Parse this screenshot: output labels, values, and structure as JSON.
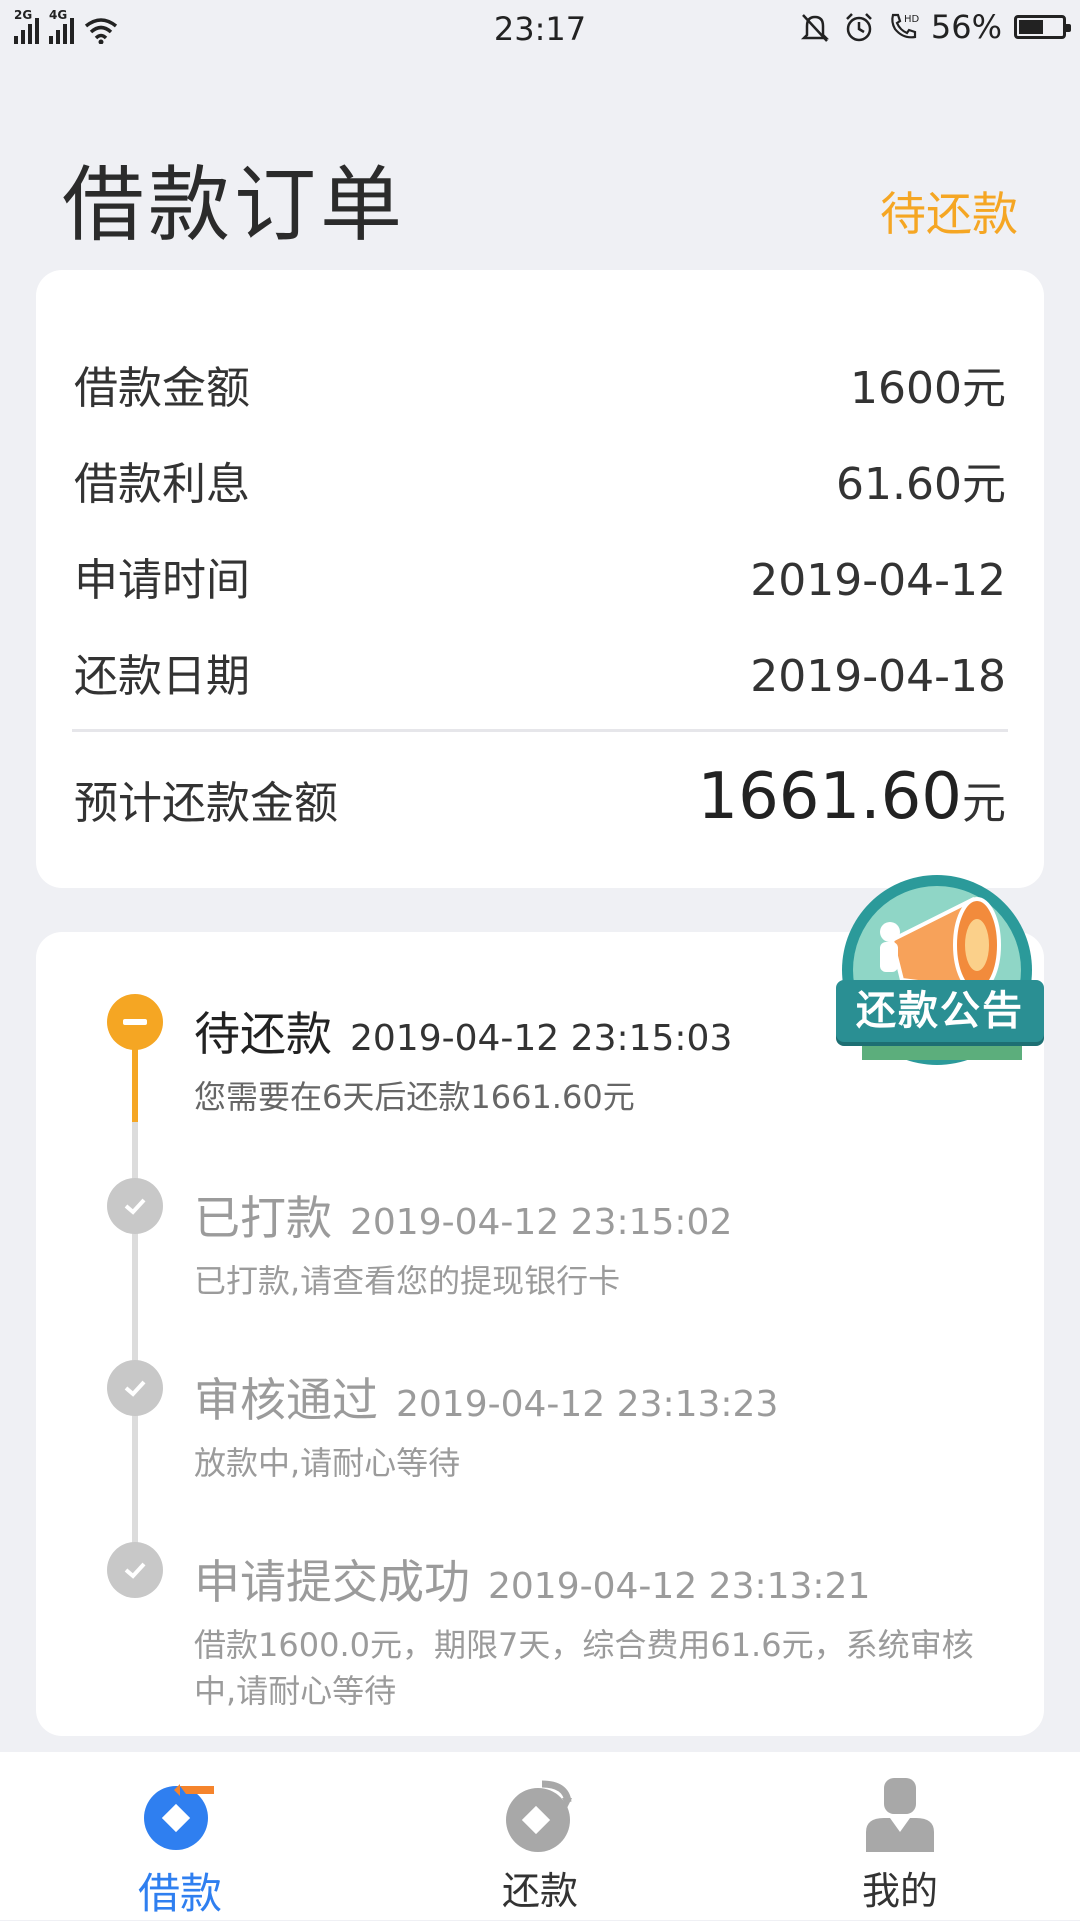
{
  "status_bar": {
    "network_1": "2G",
    "network_2": "4G",
    "time": "23:17",
    "battery": "56%",
    "icons": [
      "signal-icon",
      "wifi-icon",
      "mute-bell-icon",
      "alarm-icon",
      "hd-call-icon",
      "battery-icon"
    ]
  },
  "header": {
    "title": "借款订单",
    "status": "待还款"
  },
  "summary": {
    "rows": [
      {
        "label": "借款金额",
        "value": "1600元"
      },
      {
        "label": "借款利息",
        "value": "61.60元"
      },
      {
        "label": "申请时间",
        "value": "2019-04-12"
      },
      {
        "label": "还款日期",
        "value": "2019-04-18"
      }
    ],
    "total_label": "预计还款金额",
    "total_value": "1661.60",
    "total_unit": "元"
  },
  "badge": {
    "label": "还款公告",
    "icon": "megaphone-icon"
  },
  "timeline": [
    {
      "title": "待还款",
      "time": "2019-04-12 23:15:03",
      "desc": "您需要在6天后还款1661.60元",
      "state": "current"
    },
    {
      "title": "已打款",
      "time": "2019-04-12 23:15:02",
      "desc": "已打款,请查看您的提现银行卡",
      "state": "done"
    },
    {
      "title": "审核通过",
      "time": "2019-04-12 23:13:23",
      "desc": "放款中,请耐心等待",
      "state": "done"
    },
    {
      "title": "申请提交成功",
      "time": "2019-04-12 23:13:21",
      "desc": "借款1600.0元，期限7天，综合费用61.6元，系统审核中,请耐心等待",
      "state": "done"
    }
  ],
  "bottom_nav": [
    {
      "label": "借款",
      "icon": "borrow-icon",
      "active": true
    },
    {
      "label": "还款",
      "icon": "repay-icon",
      "active": false
    },
    {
      "label": "我的",
      "icon": "profile-icon",
      "active": false
    }
  ],
  "colors": {
    "accent": "#f5a623",
    "nav_active": "#2f7ff0",
    "badge": "#2a8f93",
    "background": "#eff0f4"
  }
}
